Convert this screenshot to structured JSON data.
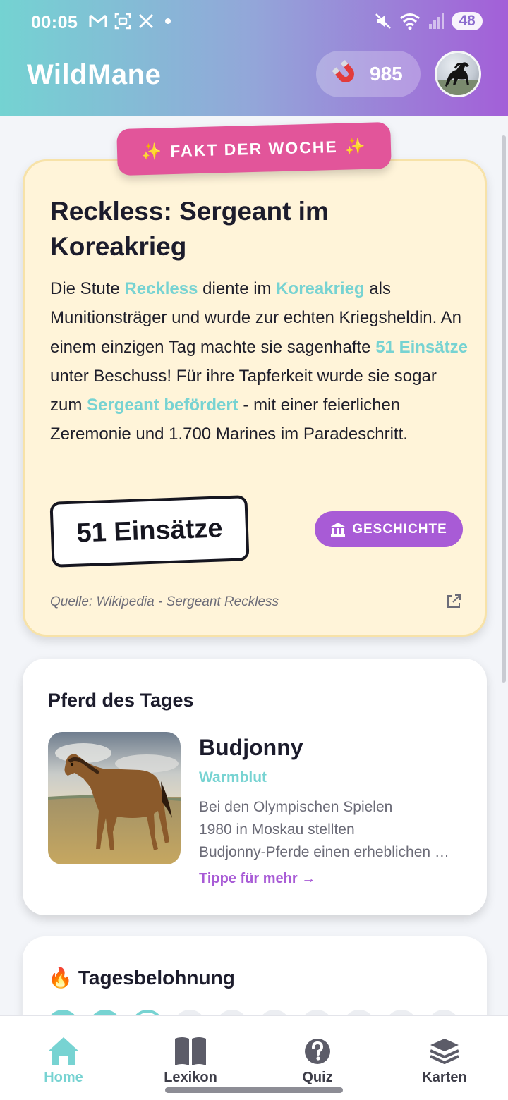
{
  "status_bar": {
    "time": "00:05",
    "battery": "48"
  },
  "header": {
    "app_title": "WildMane",
    "coins": "985"
  },
  "fact_card": {
    "badge_label": "FAKT DER WOCHE",
    "title": "Reckless: Sergeant im Koreakrieg",
    "text": {
      "t1": "Die Stute ",
      "h1": "Reckless",
      "t2": " diente im ",
      "h2": "Koreakrieg",
      "t3": " als Munitionsträger und wurde zur echten Kriegsheldin. An einem einzigen Tag machte sie sagenhafte ",
      "h3": "51 Einsätze",
      "t4": " unter Beschuss! Für ihre Tapferkeit wurde sie sogar zum ",
      "h4": "Sergeant befördert",
      "t5": " - mit einer feierlichen Zeremonie und 1.700 Marines im Paradeschritt."
    },
    "stat": "51 Einsätze",
    "category_button": "GESCHICHTE",
    "source": "Quelle: Wikipedia - Sergeant Reckless"
  },
  "horse_of_day": {
    "section_title": "Pferd des Tages",
    "name": "Budjonny",
    "breed": "Warmblut",
    "description_lines": [
      "Bei den Olympischen Spielen",
      "1980 in Moskau stellten",
      "Budjonny-Pferde einen erheblichen …"
    ],
    "more_link": "Tippe für mehr →"
  },
  "daily_reward": {
    "title": "Tagesbelohnung",
    "days_completed": 2,
    "current_day": 3,
    "total_days": 10
  },
  "bottom_nav": {
    "items": [
      {
        "label": "Home",
        "icon": "home-icon",
        "active": true
      },
      {
        "label": "Lexikon",
        "icon": "book-icon",
        "active": false
      },
      {
        "label": "Quiz",
        "icon": "question-icon",
        "active": false
      },
      {
        "label": "Karten",
        "icon": "layers-icon",
        "active": false
      }
    ]
  },
  "colors": {
    "accent_teal": "#77d3d2",
    "accent_purple": "#a85bd6",
    "badge_pink": "#e2559a",
    "fact_card_bg": "#fff4d9"
  }
}
